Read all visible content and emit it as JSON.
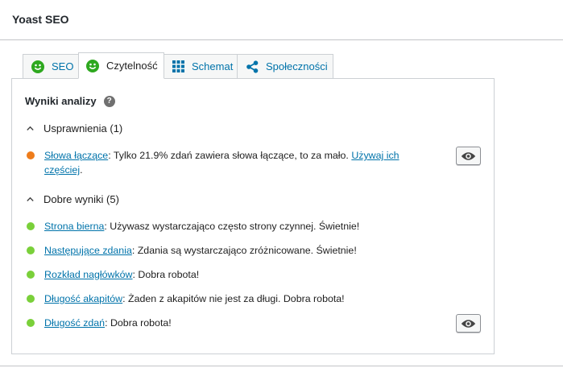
{
  "metabox": {
    "title": "Yoast SEO"
  },
  "tabs": [
    {
      "label": "SEO",
      "icon": "smiley-icon"
    },
    {
      "label": "Czytelność",
      "icon": "smiley-icon"
    },
    {
      "label": "Schemat",
      "icon": "grid-icon"
    },
    {
      "label": "Społeczności",
      "icon": "share-icon"
    }
  ],
  "analysis": {
    "heading": "Wyniki analizy",
    "help_glyph": "?",
    "improvements": {
      "label": "Usprawnienia (1)",
      "items": [
        {
          "link": "Słowa łączące",
          "text": ": Tylko 21.9% zdań zawiera słowa łączące, to za mało. ",
          "link2": "Używaj ich częściej",
          "tail": ".",
          "color": "#ee7c1b"
        }
      ]
    },
    "good": {
      "label": "Dobre wyniki (5)",
      "items": [
        {
          "link": "Strona bierna",
          "text": ": Używasz wystarczająco często strony czynnej. Świetnie!",
          "color": "#7ad03a"
        },
        {
          "link": "Następujące zdania",
          "text": ": Zdania są wystarczająco zróżnicowane. Świetnie!",
          "color": "#7ad03a"
        },
        {
          "link": "Rozkład nagłówków",
          "text": ": Dobra robota!",
          "color": "#7ad03a"
        },
        {
          "link": "Długość akapitów",
          "text": ": Żaden z akapitów nie jest za długi. Dobra robota!",
          "color": "#7ad03a"
        },
        {
          "link": "Długość zdań",
          "text": ": Dobra robota!",
          "color": "#7ad03a"
        }
      ]
    }
  },
  "colors": {
    "accent": "#0073aa",
    "good": "#7ad03a",
    "ok": "#ee7c1b",
    "smiley": "#2ea81f"
  }
}
